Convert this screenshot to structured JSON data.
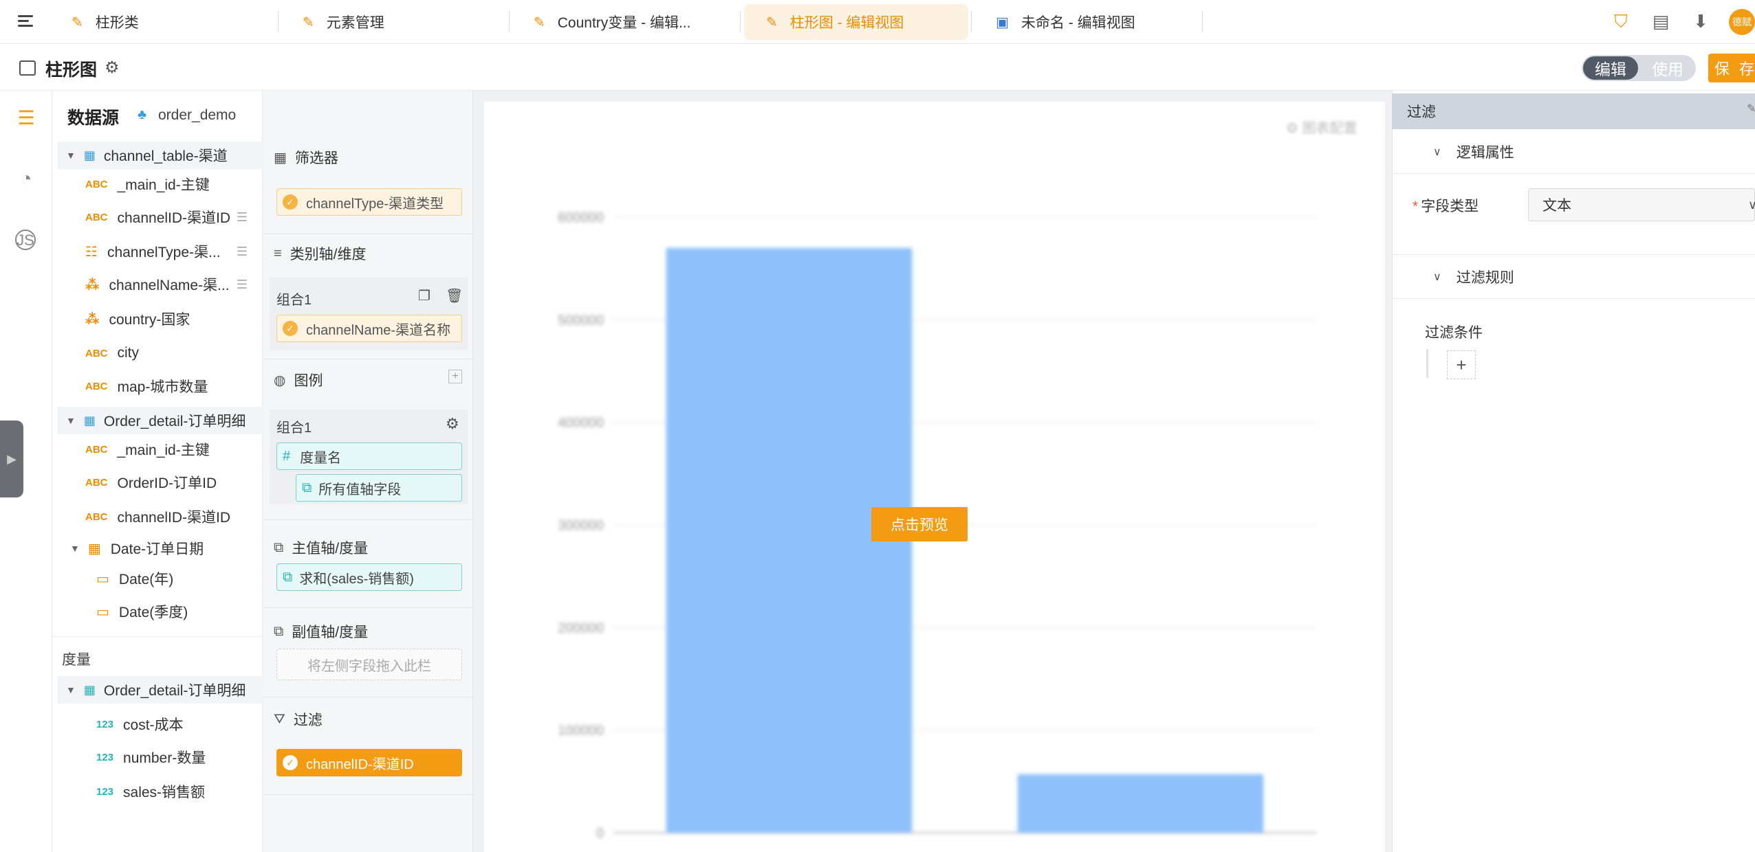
{
  "tabs": [
    {
      "label": "柱形类",
      "active": false
    },
    {
      "label": "元素管理",
      "active": false
    },
    {
      "label": "Country变量 - 编辑...",
      "active": false
    },
    {
      "label": "柱形图 - 编辑视图",
      "active": true
    },
    {
      "label": "未命名 - 编辑视图",
      "active": false
    }
  ],
  "user": {
    "avatar_text": "德赋"
  },
  "header": {
    "title": "柱形图",
    "mode_edit": "编辑",
    "mode_use": "使用",
    "save": "保 存"
  },
  "datasource": {
    "title": "数据源",
    "name": "order_demo",
    "tables": [
      {
        "name": "channel_table-渠道",
        "fields": [
          {
            "label": "_main_id-主键",
            "type": "ABC"
          },
          {
            "label": "channelID-渠道ID",
            "type": "ABC"
          },
          {
            "label": "channelType-渠...",
            "type": "list"
          },
          {
            "label": "channelName-渠...",
            "type": "geo"
          },
          {
            "label": "country-国家",
            "type": "geo"
          },
          {
            "label": "city",
            "type": "ABC"
          },
          {
            "label": "map-城市数量",
            "type": "ABC"
          }
        ]
      },
      {
        "name": "Order_detail-订单明细",
        "fields": [
          {
            "label": "_main_id-主键",
            "type": "ABC"
          },
          {
            "label": "OrderID-订单ID",
            "type": "ABC"
          },
          {
            "label": "channelID-渠道ID",
            "type": "ABC"
          }
        ],
        "date_group": {
          "label": "Date-订单日期",
          "children": [
            "Date(年)",
            "Date(季度)"
          ]
        }
      }
    ],
    "measures_label": "度量",
    "measure_table": "Order_detail-订单明细",
    "measures": [
      {
        "label": "cost-成本",
        "type": "123"
      },
      {
        "label": "number-数量",
        "type": "123"
      },
      {
        "label": "sales-销售额",
        "type": "123"
      }
    ]
  },
  "config": {
    "filter_section": "筛选器",
    "filter_chip": "channelType-渠道类型",
    "category_section": "类别轴/维度",
    "category_group": "组合1",
    "category_chip": "channelName-渠道名称",
    "legend_section": "图例",
    "legend_group": "组合1",
    "legend_chip1": "度量名",
    "legend_chip2": "所有值轴字段",
    "primary_section": "主值轴/度量",
    "primary_chip": "求和(sales-销售额)",
    "secondary_section": "副值轴/度量",
    "secondary_placeholder": "将左侧字段拖入此栏",
    "filter2_section": "过滤",
    "filter2_chip": "channelID-渠道ID"
  },
  "canvas": {
    "preview_button": "点击预览",
    "corner_label": "图表配置"
  },
  "chart_data": {
    "type": "bar",
    "categories": [
      "",
      ""
    ],
    "values": [
      570000,
      57000
    ],
    "ylim": [
      0,
      600000
    ],
    "yticks": [
      0,
      100000,
      200000,
      300000,
      400000,
      500000,
      600000
    ],
    "ytick_labels": [
      "0",
      "100000",
      "200000",
      "300000",
      "400000",
      "500000",
      "600000"
    ],
    "grid": true,
    "bar_color": "#8fc1fb"
  },
  "filter_panel": {
    "title": "过滤",
    "logic_section": "逻辑属性",
    "field_type_label": "字段类型",
    "field_type_value": "文本",
    "rule_section": "过滤规则",
    "condition_label": "过滤条件",
    "add_symbol": "+"
  },
  "colors": {
    "accent": "#f39b13",
    "teal": "#23b5b5",
    "bar": "#8fc1fb"
  }
}
